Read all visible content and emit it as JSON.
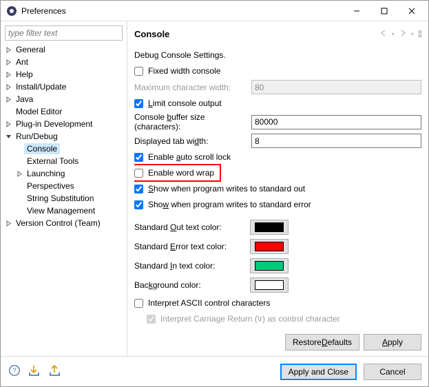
{
  "window": {
    "title": "Preferences"
  },
  "filter": {
    "placeholder": "type filter text"
  },
  "tree": [
    {
      "label": "General",
      "level": 0,
      "exp": "closed",
      "sel": false
    },
    {
      "label": "Ant",
      "level": 0,
      "exp": "closed",
      "sel": false
    },
    {
      "label": "Help",
      "level": 0,
      "exp": "closed",
      "sel": false
    },
    {
      "label": "Install/Update",
      "level": 0,
      "exp": "closed",
      "sel": false
    },
    {
      "label": "Java",
      "level": 0,
      "exp": "closed",
      "sel": false
    },
    {
      "label": "Model Editor",
      "level": 0,
      "exp": "none",
      "sel": false
    },
    {
      "label": "Plug-in Development",
      "level": 0,
      "exp": "closed",
      "sel": false
    },
    {
      "label": "Run/Debug",
      "level": 0,
      "exp": "open",
      "sel": false
    },
    {
      "label": "Console",
      "level": 1,
      "exp": "none",
      "sel": true
    },
    {
      "label": "External Tools",
      "level": 1,
      "exp": "none",
      "sel": false
    },
    {
      "label": "Launching",
      "level": 1,
      "exp": "closed",
      "sel": false
    },
    {
      "label": "Perspectives",
      "level": 1,
      "exp": "none",
      "sel": false
    },
    {
      "label": "String Substitution",
      "level": 1,
      "exp": "none",
      "sel": false
    },
    {
      "label": "View Management",
      "level": 1,
      "exp": "none",
      "sel": false
    },
    {
      "label": "Version Control (Team)",
      "level": 0,
      "exp": "closed",
      "sel": false
    }
  ],
  "page": {
    "title": "Console",
    "subtitle": "Debug Console Settings.",
    "fixed_width": {
      "checked": false,
      "label": "Fixed width console"
    },
    "max_char": {
      "label": "Maximum character width:",
      "value": "80",
      "disabled": true
    },
    "limit_output": {
      "checked": true,
      "label": "Limit console output"
    },
    "buffer_size": {
      "label": "Console buffer size (characters):",
      "value": "80000"
    },
    "tab_width": {
      "label": "Displayed tab width:",
      "value": "8"
    },
    "auto_scroll": {
      "checked": true,
      "label": "Enable auto scroll lock"
    },
    "word_wrap": {
      "checked": false,
      "label": "Enable word wrap"
    },
    "show_stdout": {
      "checked": true,
      "label": "Show when program writes to standard out"
    },
    "show_stderr": {
      "checked": true,
      "label": "Show when program writes to standard error"
    },
    "colors": {
      "stdout": {
        "label": "Standard Out text color:",
        "color": "#000000"
      },
      "stderr": {
        "label": "Standard Error text color:",
        "color": "#ff0000"
      },
      "stdin": {
        "label": "Standard In text color:",
        "color": "#00c97a"
      },
      "bg": {
        "label": "Background color:",
        "color": "#ffffff"
      }
    },
    "ascii_ctrl": {
      "checked": false,
      "label": "Interpret ASCII control characters"
    },
    "cr_ctrl": {
      "checked": true,
      "label": "Interpret Carriage Return (\\r) as control character",
      "disabled": true
    },
    "buttons": {
      "restore": "Restore Defaults",
      "apply": "Apply"
    }
  },
  "footer": {
    "apply_close": "Apply and Close",
    "cancel": "Cancel"
  }
}
